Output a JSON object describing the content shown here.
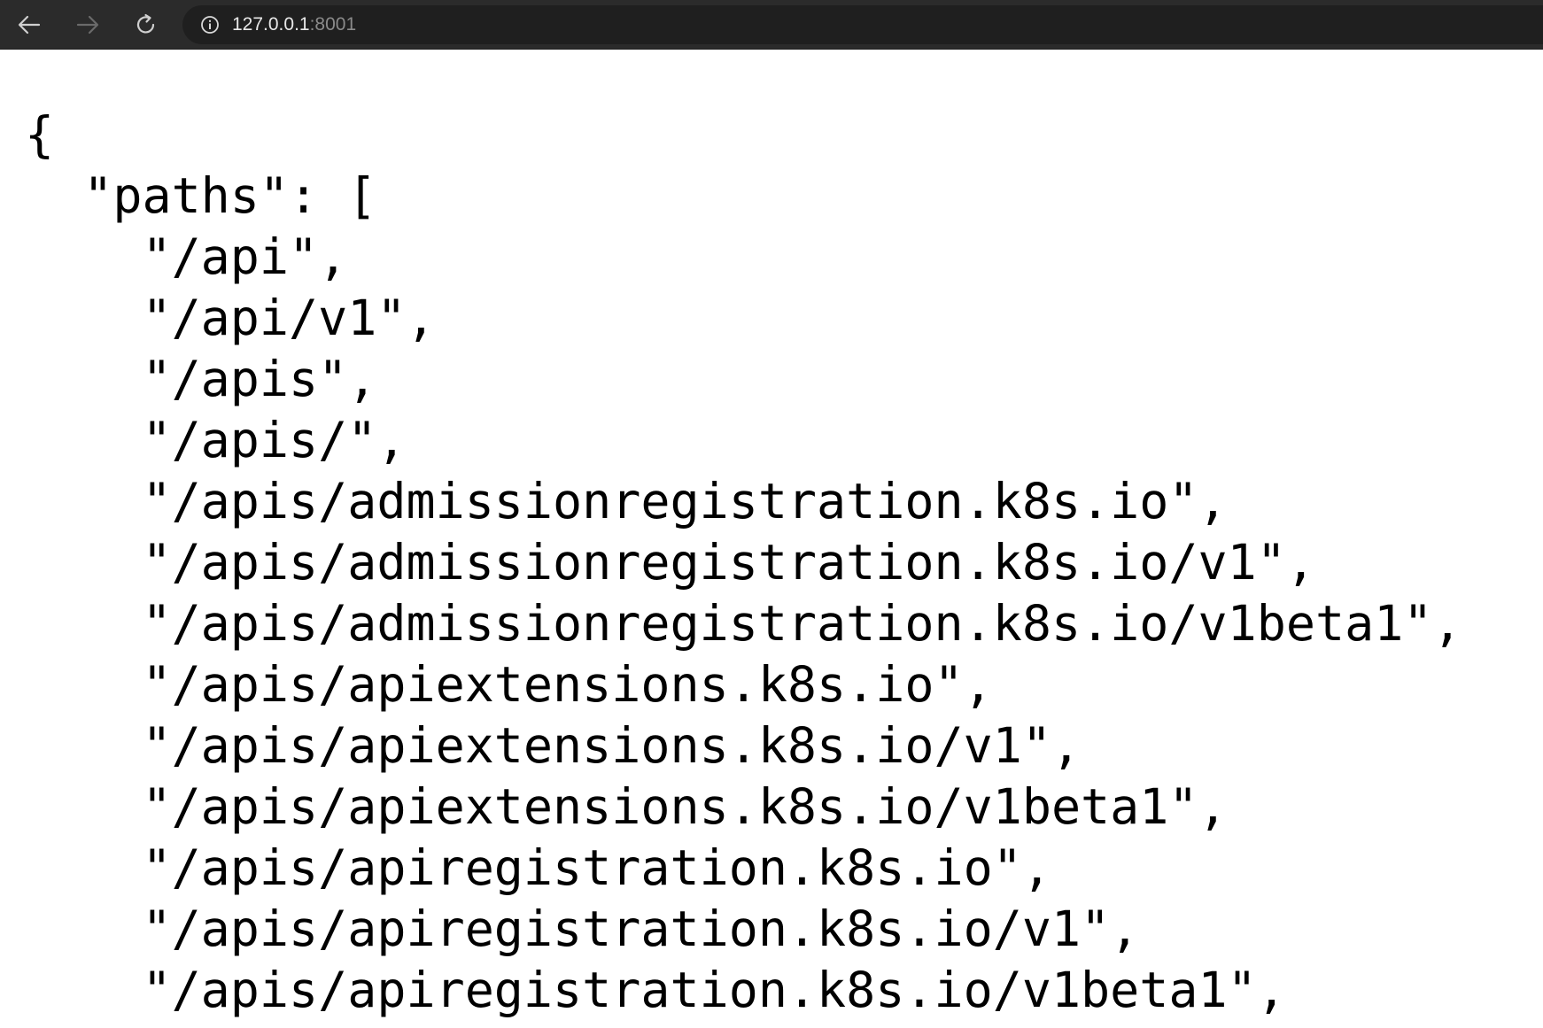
{
  "browser": {
    "url_host": "127.0.0.1",
    "url_port": ":8001",
    "icons": {
      "back": "arrow-left-icon",
      "forward": "arrow-right-icon",
      "reload": "reload-icon",
      "site_info": "info-icon"
    }
  },
  "json_view": {
    "lines": [
      "{",
      "  \"paths\": [",
      "    \"/api\",",
      "    \"/api/v1\",",
      "    \"/apis\",",
      "    \"/apis/\",",
      "    \"/apis/admissionregistration.k8s.io\",",
      "    \"/apis/admissionregistration.k8s.io/v1\",",
      "    \"/apis/admissionregistration.k8s.io/v1beta1\",",
      "    \"/apis/apiextensions.k8s.io\",",
      "    \"/apis/apiextensions.k8s.io/v1\",",
      "    \"/apis/apiextensions.k8s.io/v1beta1\",",
      "    \"/apis/apiregistration.k8s.io\",",
      "    \"/apis/apiregistration.k8s.io/v1\",",
      "    \"/apis/apiregistration.k8s.io/v1beta1\","
    ]
  },
  "colors": {
    "toolbar": "#2b2b2b",
    "omnibox": "#1f1f1f",
    "text": "#000000",
    "background": "#ffffff"
  }
}
